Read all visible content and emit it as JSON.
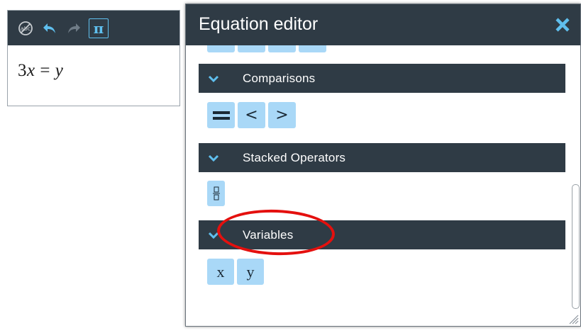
{
  "editor": {
    "toolbar": {
      "spellcheck_icon": "spellcheck-off-icon",
      "undo_icon": "undo-icon",
      "redo_icon": "redo-icon",
      "pi_label": "π"
    },
    "equation": {
      "coef": "3",
      "var1": "x",
      "op": "=",
      "var2": "y"
    }
  },
  "dialog": {
    "title": "Equation editor",
    "close_icon": "close-icon",
    "sections": [
      {
        "label": "Comparisons",
        "buttons": [
          "=",
          "<",
          ">"
        ]
      },
      {
        "label": "Stacked Operators",
        "buttons": [
          "fraction"
        ]
      },
      {
        "label": "Variables",
        "buttons": [
          "x",
          "y"
        ]
      }
    ]
  },
  "annotation": {
    "shape": "ellipse",
    "color": "#e4100e",
    "target": "Variables"
  },
  "colors": {
    "header_bg": "#2f3b45",
    "palette_button": "#a9d8f7",
    "accent": "#5fbfee"
  }
}
